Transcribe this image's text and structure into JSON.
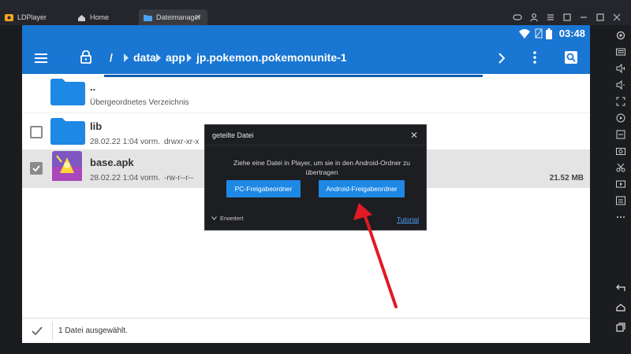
{
  "window": {
    "app_name": "LDPlayer",
    "tabs": [
      {
        "label": "Home"
      },
      {
        "label": "Dateimanager"
      }
    ]
  },
  "status_bar": {
    "time": "03:48"
  },
  "app_bar": {
    "breadcrumbs": [
      "/",
      "data",
      "app",
      "jp.pokemon.pokemonunite-1"
    ]
  },
  "files": [
    {
      "name": "..",
      "meta": "Übergeordnetes Verzeichnis",
      "perm": "",
      "size": ""
    },
    {
      "name": "lib",
      "meta": "28.02.22 1:04 vorm.",
      "perm": "drwxr-xr-x",
      "size": ""
    },
    {
      "name": "base.apk",
      "meta": "28.02.22 1:04 vorm.",
      "perm": "-rw-r--r--",
      "size": "21.52 MB"
    }
  ],
  "bottom_bar": {
    "selection_text": "1 Datei ausgewählt."
  },
  "dialog": {
    "title": "geteilte Datei",
    "message": "Ziehe eine Datei in Player, um sie in den Android-Ordner zu übertragen",
    "pc_button": "PC-Freigabeordner",
    "android_button": "Android-Freigabeordner",
    "advanced": "Erweitert",
    "tutorial": "Tutorial"
  },
  "colors": {
    "accent": "#1976d2",
    "folder": "#1e88e5",
    "button": "#1e88e5",
    "annotation_arrow": "#e01b24"
  }
}
